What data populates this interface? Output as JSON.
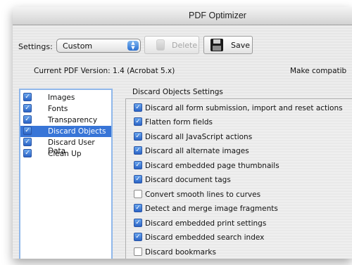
{
  "window": {
    "title": "PDF Optimizer"
  },
  "toolbar": {
    "settings_label": "Settings:",
    "settings_value": "Custom",
    "delete_label": "Delete",
    "save_label": "Save"
  },
  "info": {
    "pdf_version": "Current PDF Version: 1.4 (Acrobat 5.x)",
    "make_compatible": "Make compatib"
  },
  "panels": [
    {
      "label": "Images",
      "checked": true,
      "selected": false
    },
    {
      "label": "Fonts",
      "checked": true,
      "selected": false
    },
    {
      "label": "Transparency",
      "checked": true,
      "selected": false
    },
    {
      "label": "Discard Objects",
      "checked": true,
      "selected": true
    },
    {
      "label": "Discard User Data",
      "checked": true,
      "selected": false
    },
    {
      "label": "Clean Up",
      "checked": true,
      "selected": false
    }
  ],
  "group": {
    "title": "Discard Objects Settings",
    "options": [
      {
        "label": "Discard all form submission, import and reset actions",
        "checked": true
      },
      {
        "label": "Flatten form fields",
        "checked": true
      },
      {
        "label": "Discard all JavaScript actions",
        "checked": true
      },
      {
        "label": "Discard all alternate images",
        "checked": true
      },
      {
        "label": "Discard embedded page thumbnails",
        "checked": true
      },
      {
        "label": "Discard document tags",
        "checked": true
      },
      {
        "label": "Convert smooth lines to curves",
        "checked": false
      },
      {
        "label": "Detect and merge image fragments",
        "checked": true
      },
      {
        "label": "Discard embedded print settings",
        "checked": true
      },
      {
        "label": "Discard embedded search index",
        "checked": true
      },
      {
        "label": "Discard bookmarks",
        "checked": false
      }
    ]
  },
  "colors": {
    "selection": "#3875d7",
    "checkbox": "#2a63c6"
  }
}
